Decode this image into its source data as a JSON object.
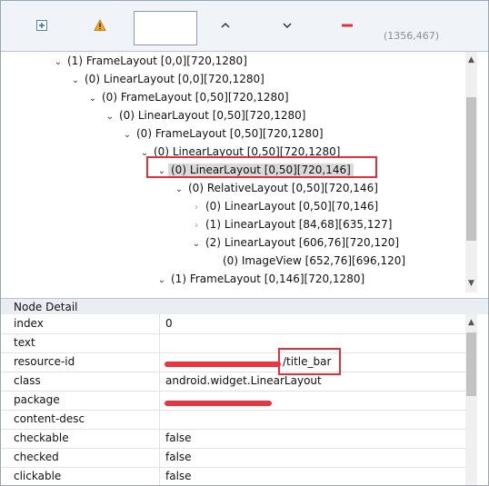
{
  "toolbar": {
    "coords_label": "(1356,467)",
    "buttons": [
      {
        "name": "expand-all",
        "icon": "plus-square-icon"
      },
      {
        "name": "toggle-naf",
        "icon": "warning-icon"
      },
      {
        "name": "up",
        "icon": "chevron-up-icon"
      },
      {
        "name": "down",
        "icon": "chevron-down-icon"
      },
      {
        "name": "clear",
        "icon": "minus-icon"
      }
    ]
  },
  "tree": {
    "nodes": [
      {
        "text": "(1) FrameLayout [0,0][720,1280]",
        "state": "expanded"
      },
      {
        "text": "(0) LinearLayout [0,0][720,1280]",
        "state": "expanded"
      },
      {
        "text": "(0) FrameLayout [0,50][720,1280]",
        "state": "expanded"
      },
      {
        "text": "(0) LinearLayout [0,50][720,1280]",
        "state": "expanded"
      },
      {
        "text": "(0) FrameLayout [0,50][720,1280]",
        "state": "expanded"
      },
      {
        "text": "(0) LinearLayout [0,50][720,1280]",
        "state": "expanded"
      },
      {
        "text": "(0) LinearLayout [0,50][720,146]",
        "state": "expanded",
        "selected": true
      },
      {
        "text": "(0) RelativeLayout [0,50][720,146]",
        "state": "expanded"
      },
      {
        "text": "(0) LinearLayout [0,50][70,146]",
        "state": "collapsed"
      },
      {
        "text": "(1) LinearLayout [84,68][635,127]",
        "state": "collapsed"
      },
      {
        "text": "(2) LinearLayout [606,76][720,120]",
        "state": "expanded"
      },
      {
        "text": "(0) ImageView [652,76][696,120]",
        "state": "leaf"
      },
      {
        "text": "(1) FrameLayout [0,146][720,1280]",
        "state": "expanded"
      }
    ]
  },
  "detail": {
    "title": "Node Detail",
    "rows": [
      {
        "key": "index",
        "value": "0"
      },
      {
        "key": "text",
        "value": ""
      },
      {
        "key": "resource-id",
        "value": "/title_bar"
      },
      {
        "key": "class",
        "value": "android.widget.LinearLayout"
      },
      {
        "key": "package",
        "value": ""
      },
      {
        "key": "content-desc",
        "value": ""
      },
      {
        "key": "checkable",
        "value": "false"
      },
      {
        "key": "checked",
        "value": "false"
      },
      {
        "key": "clickable",
        "value": "false"
      }
    ]
  },
  "colors": {
    "accent_red": "#e0323c",
    "selection": "#d9d9d9",
    "toolbar_bg": "#f0f3f8"
  }
}
